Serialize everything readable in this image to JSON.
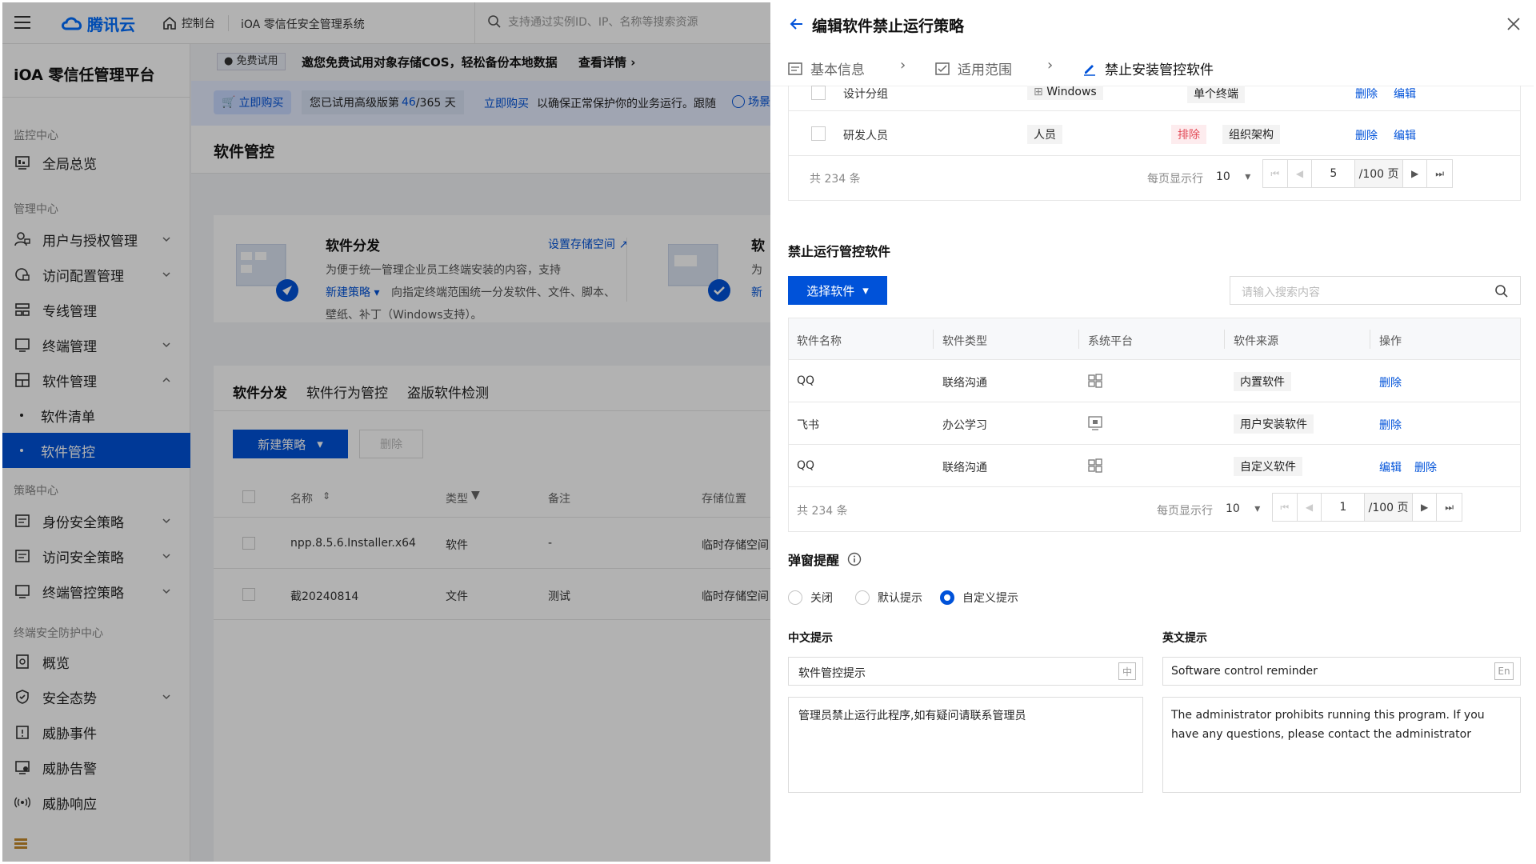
{
  "topbar": {
    "brand": "腾讯云",
    "console": "控制台",
    "product": "iOA 零信任安全管理系统",
    "search_placeholder": "支持通过实例ID、IP、名称等搜索资源"
  },
  "sidebar": {
    "platform_title": "iOA 零信任管理平台",
    "sections": {
      "monitor": "监控中心",
      "manage": "管理中心",
      "policy": "策略中心",
      "endpoint": "终端安全防护中心"
    },
    "items": {
      "overview_all": "全局总览",
      "users": "用户与授权管理",
      "access_cfg": "访问配置管理",
      "line": "专线管理",
      "terminal": "终端管理",
      "software": "软件管理",
      "software_list": "软件清单",
      "software_ctrl": "软件管控",
      "identity_policy": "身份安全策略",
      "access_policy": "访问安全策略",
      "terminal_policy": "终端管控策略",
      "overview": "概览",
      "posture": "安全态势",
      "threat_events": "威胁事件",
      "threat_alerts": "威胁告警",
      "threat_response": "威胁响应"
    }
  },
  "background": {
    "trial_badge": "免费试用",
    "banner1": "邀您免费试用对象存储COS，轻松备份本地数据",
    "banner1_link": "查看详情",
    "buy_btn": "立即购买",
    "trial_text_prefix": "您已试用高级版第",
    "trial_days": "46",
    "trial_total": "/365 天",
    "buy_link": "立即购买",
    "banner2_tail": "以确保正常保护你的业务运行。跟随",
    "scene": "场景",
    "page_title": "软件管控",
    "card1_title": "软件分发",
    "card1_link": "设置存储空间",
    "card1_line1": "为便于统一管理企业员工终端安装的内容，支持",
    "card1_new": "新建策略",
    "card1_line2": "向指定终端范围统一分发软件、文件、脚本、",
    "card1_line3": "壁纸、补丁（Windows支持）。",
    "card2_title": "软",
    "card2_peek1": "为",
    "card2_peek2": "新",
    "tabs": [
      "软件分发",
      "软件行为管控",
      "盗版软件检测"
    ],
    "new_policy_btn": "新建策略",
    "delete_btn": "删除",
    "columns": [
      "名称",
      "类型",
      "备注",
      "存储位置"
    ],
    "rows": [
      [
        "npp.8.5.6.Installer.x64",
        "软件",
        "-",
        "临时存储空间"
      ],
      [
        "截20240814",
        "文件",
        "测试",
        "临时存储空间"
      ]
    ]
  },
  "drawer": {
    "title": "编辑软件禁止运行策略",
    "steps": [
      "基本信息",
      "适用范围",
      "禁止安装管控软件"
    ],
    "scope_rows": [
      {
        "name": "设计分组",
        "type": "Windows",
        "scope": "单个终端",
        "actions": [
          "删除",
          "编辑"
        ]
      },
      {
        "name": "研发人员",
        "type": "人员",
        "exclude": "排除",
        "scope": "组织架构",
        "actions": [
          "删除",
          "编辑"
        ]
      }
    ],
    "pager1": {
      "total": "共 234 条",
      "per_page_label": "每页显示行",
      "per_page": "10",
      "page": "5",
      "pages": "/100 页"
    },
    "section_title": "禁止运行管控软件",
    "select_btn": "选择软件",
    "search_placeholder": "请输入搜索内容",
    "sw_columns": [
      "软件名称",
      "软件类型",
      "系统平台",
      "软件来源",
      "操作"
    ],
    "sw_rows": [
      {
        "name": "QQ",
        "category": "联络沟通",
        "platform": "windows-icon",
        "source": "内置软件",
        "actions": [
          "删除"
        ]
      },
      {
        "name": "飞书",
        "category": "办公学习",
        "platform": "monitor-icon",
        "source": "用户安装软件",
        "actions": [
          "删除"
        ]
      },
      {
        "name": "QQ",
        "category": "联络沟通",
        "platform": "windows-icon",
        "source": "自定义软件",
        "actions": [
          "编辑",
          "删除"
        ]
      }
    ],
    "pager2": {
      "total": "共 234 条",
      "per_page_label": "每页显示行",
      "per_page": "10",
      "page": "1",
      "pages": "/100 页"
    },
    "popup_title": "弹窗提醒",
    "radio_options": [
      "关闭",
      "默认提示",
      "自定义提示"
    ],
    "radio_selected": "自定义提示",
    "cn_label": "中文提示",
    "en_label": "英文提示",
    "cn_title_value": "软件管控提示",
    "cn_title_tag": "中",
    "en_title_value": "Software control reminder",
    "en_title_tag": "En",
    "cn_body": "管理员禁止运行此程序,如有疑问请联系管理员",
    "en_body": "The administrator prohibits running this program. If you have any questions, please contact the administrator"
  },
  "colors": {
    "primary": "#0052d9",
    "danger": "#e34d59",
    "danger_bg": "#fdecee"
  }
}
